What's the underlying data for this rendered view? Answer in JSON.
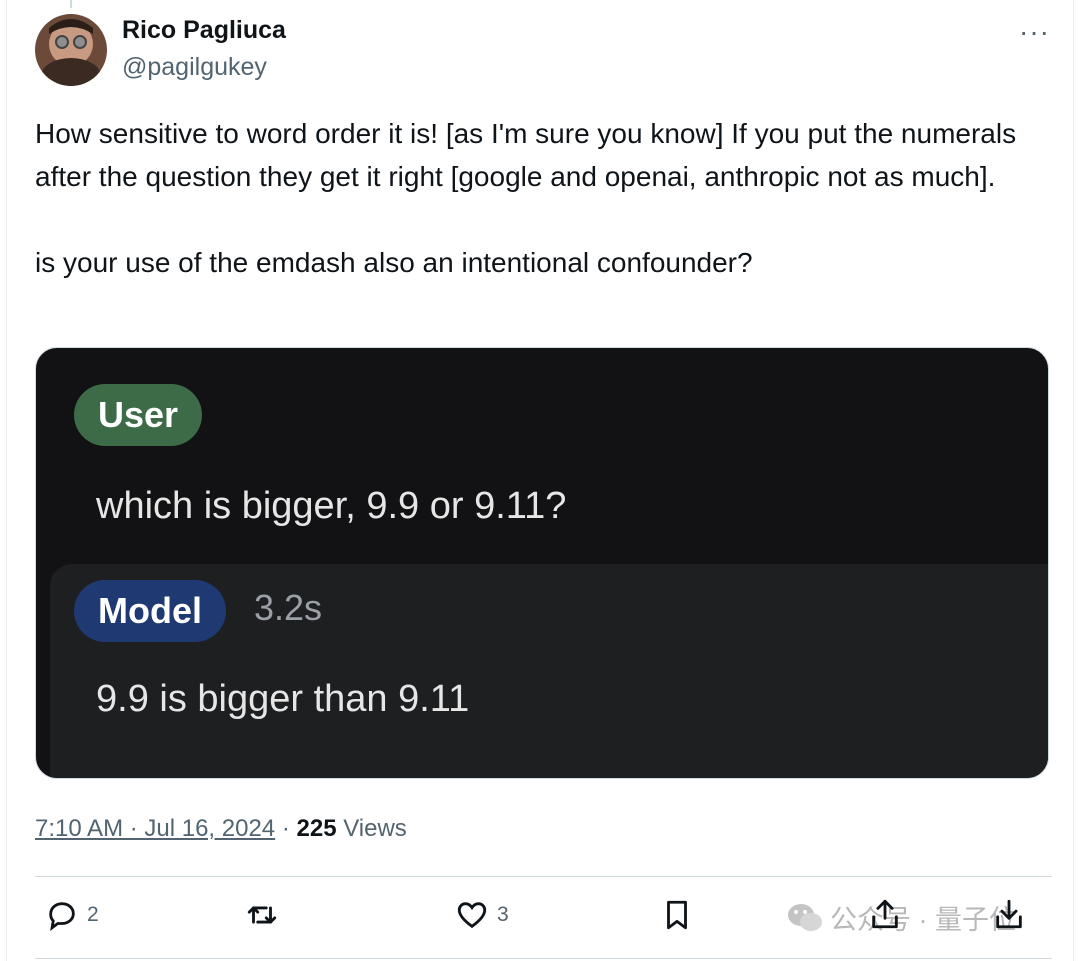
{
  "author": {
    "name": "Rico Pagliuca",
    "handle": "@pagilgukey"
  },
  "more_label": "···",
  "tweet": {
    "paragraph1": "How sensitive to word order it is! [as I'm sure you know] If you put the numerals after the question they get it right [google and openai, anthropic not as much].",
    "paragraph2": "is your use of the emdash also an intentional confounder?"
  },
  "media": {
    "user_label": "User",
    "question": "which is bigger, 9.9 or 9.11?",
    "model_label": "Model",
    "timing": "3.2s",
    "answer": "9.9 is bigger than 9.11"
  },
  "meta": {
    "timestamp": "7:10 AM · Jul 16, 2024",
    "separator": "·",
    "views_count": "225",
    "views_label": "Views"
  },
  "actions": {
    "reply_count": "2",
    "retweet_count": "",
    "like_count": "3"
  },
  "watermark": {
    "text": "公众号 · 量子位"
  },
  "icons": {
    "reply": "reply-icon",
    "retweet": "retweet-icon",
    "like": "heart-icon",
    "bookmark": "bookmark-icon",
    "share": "share-icon",
    "download": "download-icon"
  },
  "colors": {
    "user_chip": "#3d6b47",
    "model_chip": "#1f3a73",
    "media_bg": "#121214"
  }
}
